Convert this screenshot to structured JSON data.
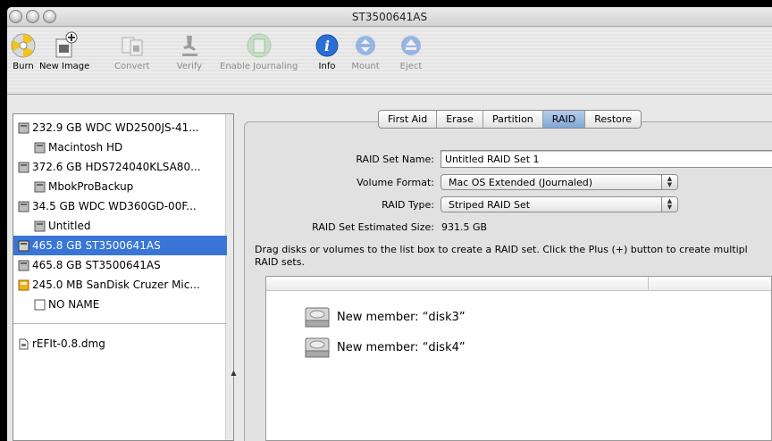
{
  "window": {
    "title": "ST3500641AS"
  },
  "toolbar": {
    "burn": "Burn",
    "new_image": "New Image",
    "convert": "Convert",
    "verify": "Verify",
    "enable_journaling": "Enable Journaling",
    "info": "Info",
    "mount": "Mount",
    "eject": "Eject"
  },
  "sidebar": {
    "items": [
      {
        "label": "232.9 GB WDC WD2500JS-41...",
        "level": 0,
        "kind": "disk"
      },
      {
        "label": "Macintosh HD",
        "level": 1,
        "kind": "volume"
      },
      {
        "label": "372.6 GB HDS724040KLSA80...",
        "level": 0,
        "kind": "disk"
      },
      {
        "label": "MbokProBackup",
        "level": 1,
        "kind": "volume"
      },
      {
        "label": "34.5 GB WDC WD360GD-00F...",
        "level": 0,
        "kind": "disk"
      },
      {
        "label": "Untitled",
        "level": 1,
        "kind": "volume"
      },
      {
        "label": "465.8 GB ST3500641AS",
        "level": 0,
        "kind": "disk",
        "selected": true
      },
      {
        "label": "465.8 GB ST3500641AS",
        "level": 0,
        "kind": "disk"
      },
      {
        "label": "245.0 MB SanDisk Cruzer Mic...",
        "level": 0,
        "kind": "usb"
      },
      {
        "label": "NO NAME",
        "level": 1,
        "kind": "empty-volume"
      }
    ],
    "images": [
      {
        "label": "rEFIt-0.8.dmg"
      }
    ]
  },
  "tabs": [
    "First Aid",
    "Erase",
    "Partition",
    "RAID",
    "Restore"
  ],
  "active_tab": "RAID",
  "raid": {
    "set_name_label": "RAID Set Name:",
    "set_name_value": "Untitled RAID Set 1",
    "volume_format_label": "Volume Format:",
    "volume_format_value": "Mac OS Extended (Journaled)",
    "raid_type_label": "RAID Type:",
    "raid_type_value": "Striped RAID Set",
    "estimated_label": "RAID Set Estimated Size:",
    "estimated_value": "931.5 GB",
    "help_line1": "Drag disks or volumes to the list box to create a RAID set. Click the Plus (+) button to create multipl",
    "help_line2": "RAID sets.",
    "members": [
      "New member: “disk3”",
      "New member: “disk4”"
    ]
  },
  "colors": {
    "selection": "#3875d7",
    "info_blue": "#2a6fd6"
  }
}
